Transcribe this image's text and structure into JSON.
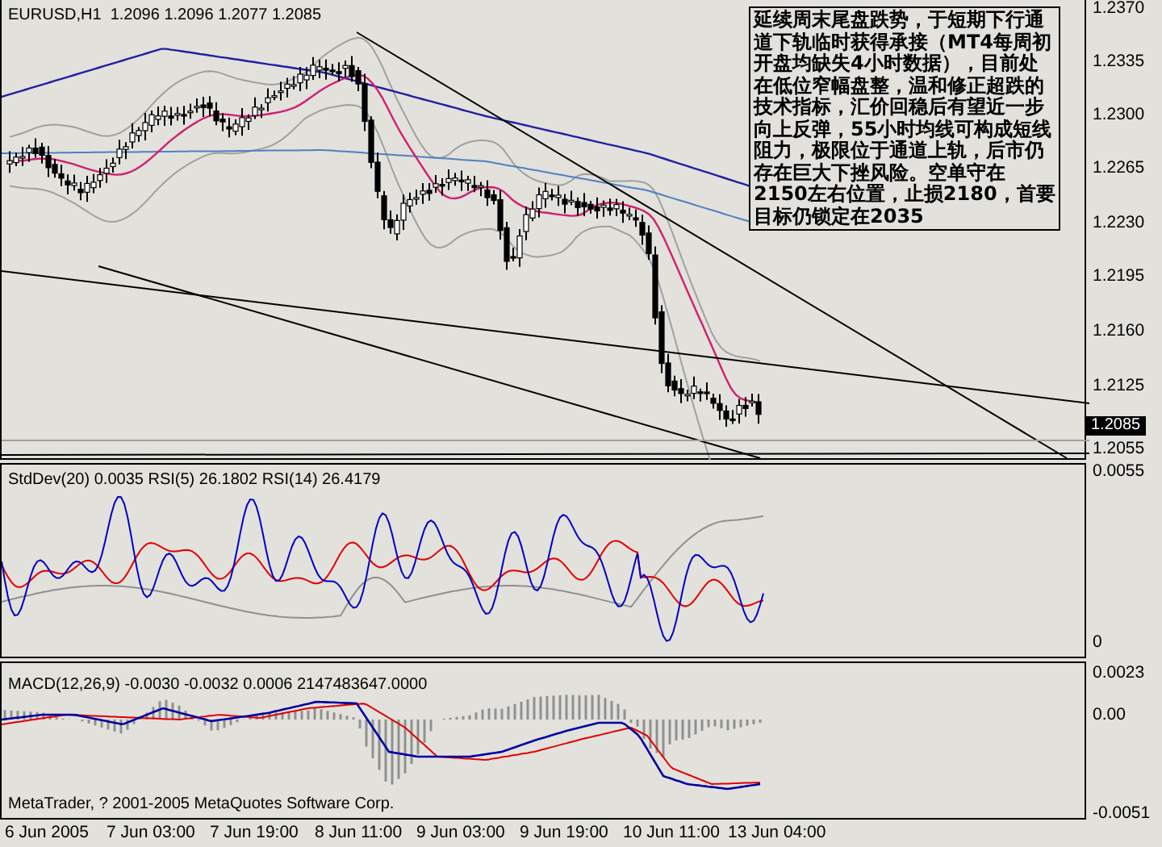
{
  "symbol_header": {
    "symbol": "EURUSD,H1",
    "ohlc": [
      "1.2096",
      "1.2096",
      "1.2077",
      "1.2085"
    ]
  },
  "annotation": {
    "text": "延续周末尾盘跌势，于短期下行通道下轨临时获得承接（MT4每周初开盘均缺失4小时数据），目前处在低位窄幅盘整，温和修正超跌的技术指标，汇价回稳后有望近一步向上反弹，55小时均线可构成短线阻力，极限位于通道上轨，后市仍存在巨大下挫风险。空单守在2150左右位置，止损2180，首要目标仍锁定在2035"
  },
  "price_axis": {
    "labels": [
      "1.2370",
      "1.2335",
      "1.2300",
      "1.2265",
      "1.2230",
      "1.2195",
      "1.2160",
      "1.2125",
      "1.2055"
    ],
    "current_price": "1.2085"
  },
  "indicator_panes": [
    {
      "label": "StdDev(20) 0.0035  RSI(5) 26.1802  RSI(14) 26.4179",
      "axis_labels": [
        "0.0055",
        "0"
      ]
    },
    {
      "label": "MACD(12,26,9) -0.0030 -0.0032 0.0006 2147483647.0000",
      "axis_labels": [
        "0.0023",
        "0.00",
        "-0.0051"
      ]
    }
  ],
  "copyright": "MetaTrader, ? 2001-2005 MetaQuotes Software Corp.",
  "time_axis": [
    "6 Jun 2005",
    "7 Jun 03:00",
    "7 Jun 19:00",
    "8 Jun 11:00",
    "9 Jun 03:00",
    "9 Jun 19:00",
    "10 Jun 11:00",
    "13 Jun 04:00"
  ]
}
